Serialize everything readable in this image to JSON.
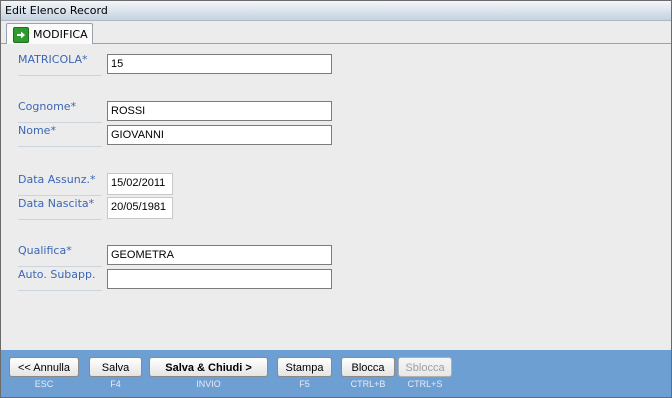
{
  "window": {
    "title": "Edit Elenco Record"
  },
  "tab": {
    "label": "MODIFICA",
    "icon": "arrow-right-icon"
  },
  "fields": {
    "matricola": {
      "label": "MATRICOLA*",
      "value": "15"
    },
    "cognome": {
      "label": "Cognome*",
      "value": "ROSSI"
    },
    "nome": {
      "label": "Nome*",
      "value": "GIOVANNI"
    },
    "data_assunz": {
      "label": "Data Assunz.*",
      "value": "15/02/2011"
    },
    "data_nascita": {
      "label": "Data Nascita*",
      "value": "20/05/1981"
    },
    "qualifica": {
      "label": "Qualifica*",
      "value": "GEOMETRA"
    },
    "auto_subapp": {
      "label": "Auto. Subapp.",
      "value": ""
    }
  },
  "buttons": {
    "annulla": {
      "label": "<< Annulla",
      "shortcut": "ESC"
    },
    "salva": {
      "label": "Salva",
      "shortcut": "F4"
    },
    "salva_chiudi": {
      "label": "Salva & Chiudi  >",
      "shortcut": "INVIO"
    },
    "stampa": {
      "label": "Stampa",
      "shortcut": "F5"
    },
    "blocca": {
      "label": "Blocca",
      "shortcut": "CTRL+B"
    },
    "sblocca": {
      "label": "Sblocca",
      "shortcut": "CTRL+S"
    }
  },
  "colors": {
    "label_blue": "#3c66b5",
    "footer_blue": "#6e9fd3",
    "tab_icon_green": "#2e9b2e"
  }
}
